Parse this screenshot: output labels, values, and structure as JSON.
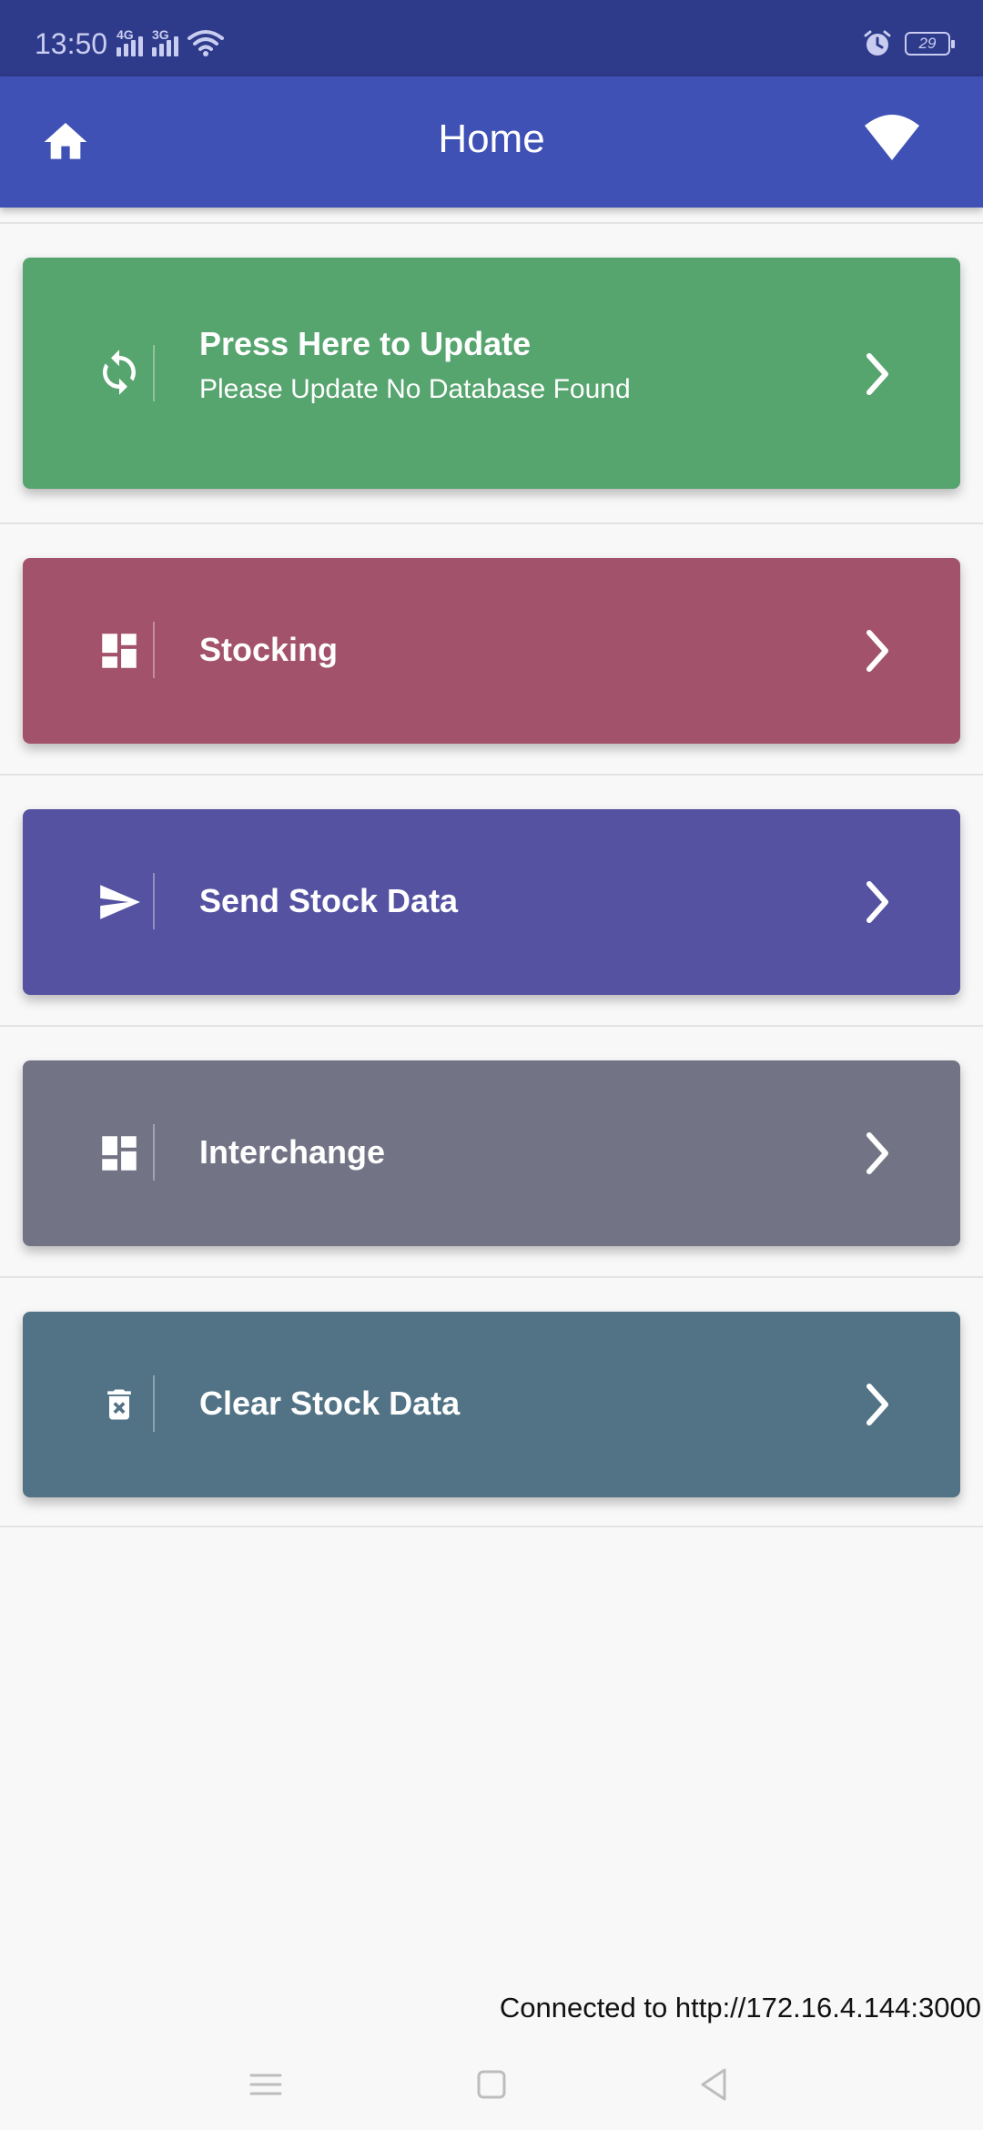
{
  "status_bar": {
    "time": "13:50",
    "network1": "4G",
    "network2": "3G",
    "battery": "29",
    "icons": [
      "signal-icon",
      "wifi-icon",
      "alarm-icon",
      "battery-icon"
    ]
  },
  "app_bar": {
    "title": "Home",
    "left_icon": "home-icon",
    "right_icon": "wifi-icon"
  },
  "menu": [
    {
      "title": "Press Here to Update",
      "subtitle": "Please Update No Database Found",
      "icon": "refresh-icon",
      "color": "#56a46e"
    },
    {
      "title": "Stocking",
      "icon": "dashboard-icon",
      "color": "#a2536b"
    },
    {
      "title": "Send Stock Data",
      "icon": "send-icon",
      "color": "#5552a2"
    },
    {
      "title": "Interchange",
      "icon": "dashboard-icon",
      "color": "#727385"
    },
    {
      "title": "Clear Stock Data",
      "icon": "delete-icon",
      "color": "#517385"
    }
  ],
  "footer": {
    "connection_text": "Connected to http://172.16.4.144:3000"
  },
  "colors": {
    "status_bar": "#2e3a8a",
    "app_bar": "#3f51b5",
    "background": "#f8f8f8"
  },
  "nav_icons": [
    "menu-icon",
    "square-icon",
    "back-icon"
  ]
}
